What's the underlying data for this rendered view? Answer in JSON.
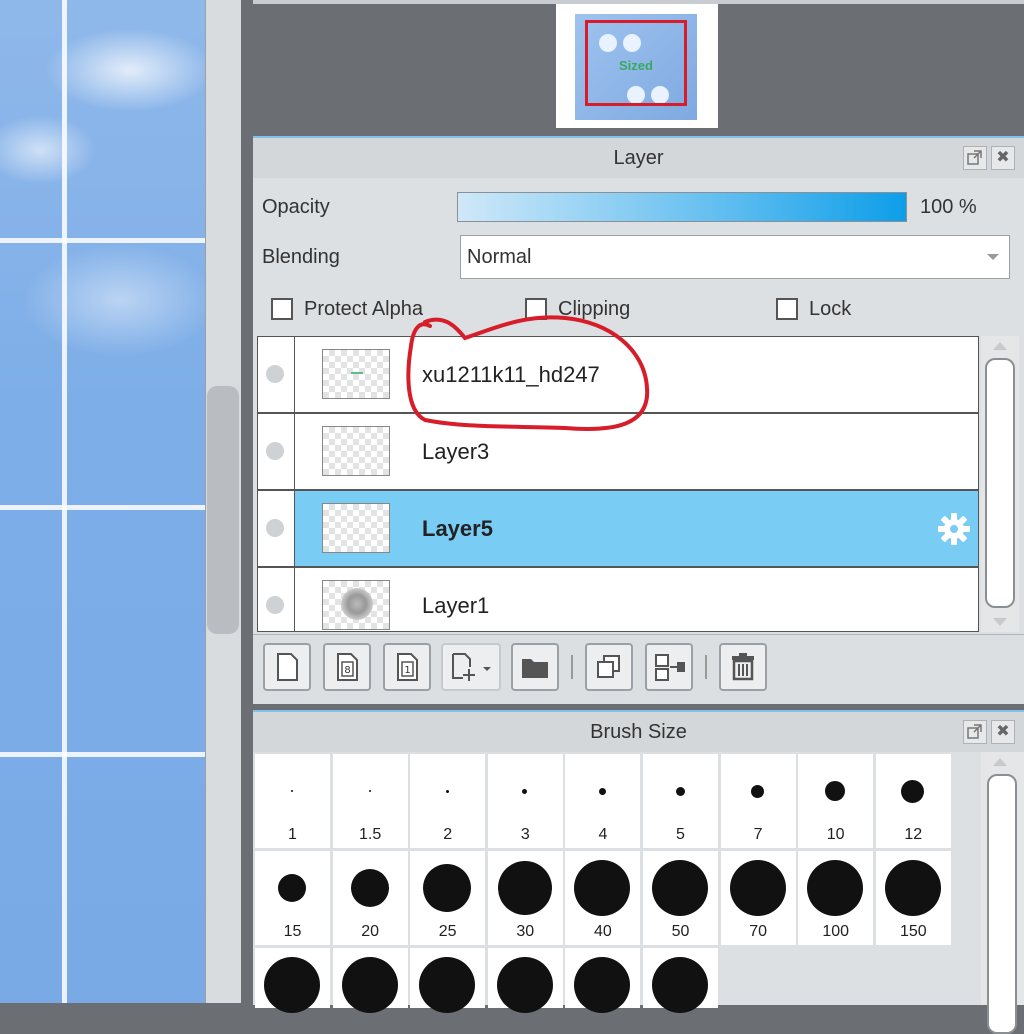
{
  "navigator": {
    "thumbnail_text": "Sized"
  },
  "layer_panel": {
    "title": "Layer",
    "opacity_label": "Opacity",
    "opacity_value": "100 %",
    "opacity_percent": 100,
    "blending_label": "Blending",
    "blending_value": "Normal",
    "protect_alpha_label": "Protect Alpha",
    "clipping_label": "Clipping",
    "lock_label": "Lock",
    "layers": [
      {
        "name": "xu1211k11_hd247",
        "selected": false
      },
      {
        "name": "Layer3",
        "selected": false
      },
      {
        "name": "Layer5",
        "selected": true
      },
      {
        "name": "Layer1",
        "selected": false
      }
    ],
    "toolbar_icons": [
      "new-layer-icon",
      "new-8bit-layer-icon",
      "new-1bit-layer-icon",
      "add-layer-dropdown-icon",
      "new-folder-icon",
      "duplicate-layer-icon",
      "merge-down-icon",
      "delete-layer-icon"
    ]
  },
  "brush_panel": {
    "title": "Brush Size",
    "sizes": [
      "1",
      "1.5",
      "2",
      "3",
      "4",
      "5",
      "7",
      "10",
      "12",
      "15",
      "20",
      "25",
      "30",
      "40",
      "50",
      "70",
      "100",
      "150"
    ]
  },
  "colors": {
    "selected_row": "#79ccf4",
    "annotation": "#d71c2a",
    "panel_bg": "#dde0e3"
  }
}
